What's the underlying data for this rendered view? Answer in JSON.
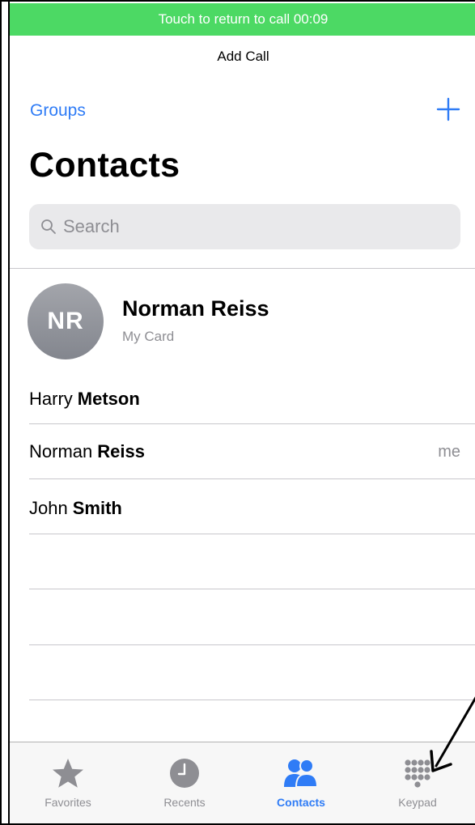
{
  "call_banner": {
    "text": "Touch to return to call 00:09"
  },
  "nav": {
    "title": "Add Call",
    "left_label": "Groups",
    "right_icon": "plus-icon"
  },
  "page": {
    "title": "Contacts"
  },
  "search": {
    "placeholder": "Search",
    "icon": "search-icon"
  },
  "my_card": {
    "initials": "NR",
    "name": "Norman Reiss",
    "subtitle": "My Card"
  },
  "contacts": [
    {
      "first": "Harry",
      "last": "Metson",
      "tag": ""
    },
    {
      "first": "Norman",
      "last": "Reiss",
      "tag": "me"
    },
    {
      "first": "John",
      "last": "Smith",
      "tag": ""
    }
  ],
  "tab_bar": {
    "items": [
      {
        "label": "Favorites",
        "icon": "star-icon",
        "active": false
      },
      {
        "label": "Recents",
        "icon": "clock-icon",
        "active": false
      },
      {
        "label": "Contacts",
        "icon": "people-icon",
        "active": true
      },
      {
        "label": "Keypad",
        "icon": "keypad-icon",
        "active": false
      }
    ]
  },
  "colors": {
    "banner_green": "#4cd964",
    "accent_blue": "#2f7cf6",
    "inactive_gray": "#8e8e93",
    "search_bg": "#e9e9eb"
  }
}
